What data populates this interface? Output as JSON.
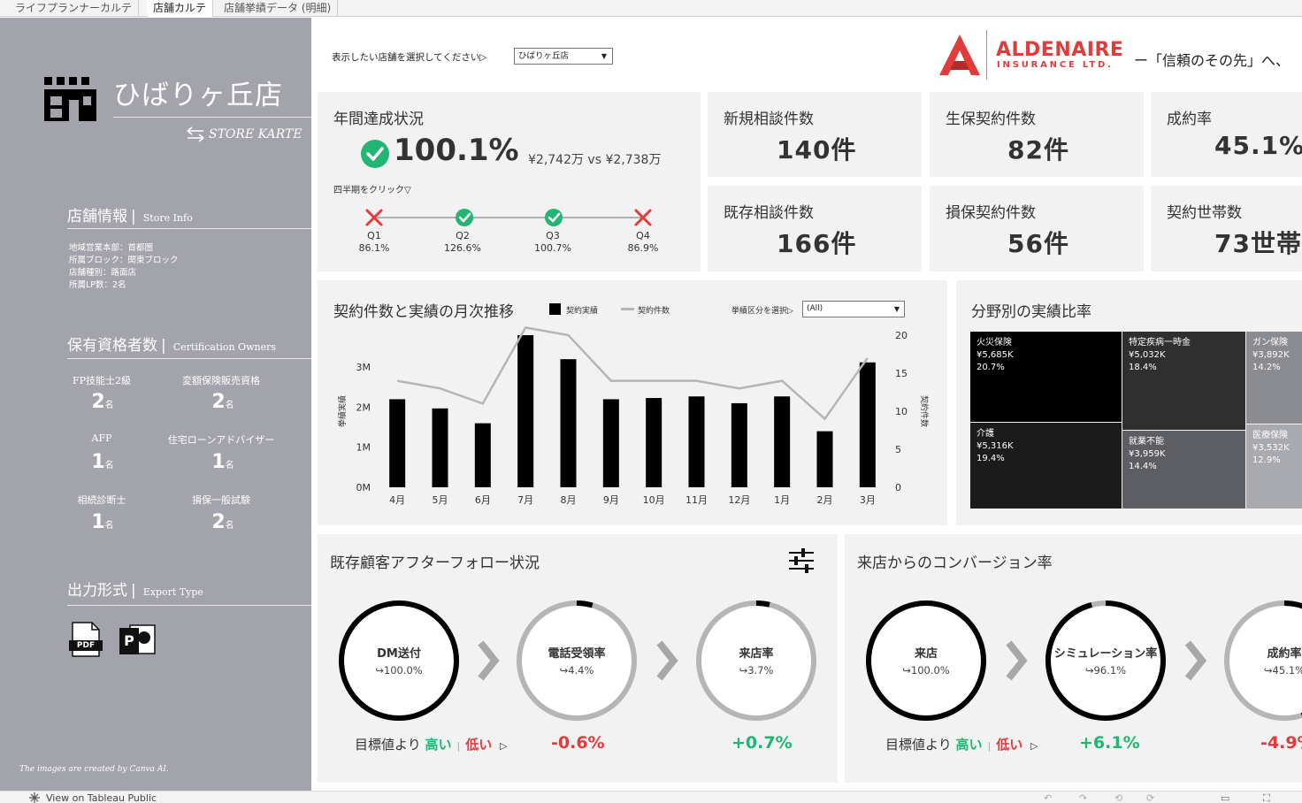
{
  "tabs": [
    {
      "label": "ライフプランナーカルテ"
    },
    {
      "label": "店舗カルテ"
    },
    {
      "label": "店舗挙績データ (明細)"
    }
  ],
  "sidebar": {
    "store_name": "ひばりヶ丘店",
    "store_karte": "STORE KARTE",
    "store_info": {
      "title": "店舗情報",
      "subtitle": "Store Info",
      "lines": [
        "地域営業本部：首都圏",
        "所属ブロック：関東ブロック",
        "店舗種別：路面店",
        "所属LP数：2名"
      ]
    },
    "certifications": {
      "title": "保有資格者数",
      "subtitle": "Certification Owners",
      "unit": "名",
      "items": [
        {
          "label": "FP技能士2級",
          "count": "2"
        },
        {
          "label": "変額保険販売資格",
          "count": "2"
        },
        {
          "label": "AFP",
          "count": "1"
        },
        {
          "label": "住宅ローンアドバイザー",
          "count": "1"
        },
        {
          "label": "相続診断士",
          "count": "1"
        },
        {
          "label": "損保一般試験",
          "count": "2"
        }
      ]
    },
    "export": {
      "title": "出力形式",
      "subtitle": "Export Type",
      "pdf_label": "PDF",
      "ppt_label": "P"
    },
    "credit": "The images are created by Canva AI."
  },
  "header": {
    "select_label": "表示したい店舗を選択してください▷",
    "select_value": "ひばりヶ丘店",
    "brand_name": "ALDENAIRE",
    "brand_sub": "INSURANCE LTD.",
    "tagline": "ー「信頼のその先」へ、"
  },
  "annual": {
    "title": "年間達成状況",
    "rate": "100.1%",
    "amounts": "¥2,742万 vs ¥2,738万",
    "hint": "四半期をクリック▽",
    "quarters": [
      {
        "label": "Q1",
        "value": "86.1%",
        "achieved": false
      },
      {
        "label": "Q2",
        "value": "126.6%",
        "achieved": true
      },
      {
        "label": "Q3",
        "value": "100.7%",
        "achieved": true
      },
      {
        "label": "Q4",
        "value": "86.9%",
        "achieved": false
      }
    ]
  },
  "kpis": [
    {
      "title": "新規相談件数",
      "value": "140件"
    },
    {
      "title": "生保契約件数",
      "value": "82件"
    },
    {
      "title": "成約率",
      "value": "45.1%"
    },
    {
      "title": "既存相談件数",
      "value": "166件"
    },
    {
      "title": "損保契約件数",
      "value": "56件"
    },
    {
      "title": "契約世帯数",
      "value": "73世帯"
    }
  ],
  "monthly": {
    "title": "契約件数と実績の月次推移",
    "legend_bar": "契約実績",
    "legend_line": "契約件数",
    "filter_label": "挙績区分を選択▷",
    "filter_value": "(All)"
  },
  "treemap": {
    "title": "分野別の実績比率",
    "cells": [
      {
        "name": "火災保険",
        "amount": "¥5,685K",
        "pct": "20.7%"
      },
      {
        "name": "特定疾病一時金",
        "amount": "¥5,032K",
        "pct": "18.4%"
      },
      {
        "name": "ガン保険",
        "amount": "¥3,892K",
        "pct": "14.2%"
      },
      {
        "name": "介護",
        "amount": "¥5,316K",
        "pct": "19.4%"
      },
      {
        "name": "就業不能",
        "amount": "¥3,959K",
        "pct": "14.4%"
      },
      {
        "name": "医療保険",
        "amount": "¥3,532K",
        "pct": "12.9%"
      }
    ]
  },
  "followup": {
    "title": "既存顧客アフターフォロー状況",
    "rings": [
      {
        "title": "DM送付",
        "value": "↪100.0%",
        "fraction": 1.0
      },
      {
        "title": "電話受領率",
        "value": "↪4.4%",
        "fraction": 0.044
      },
      {
        "title": "来店率",
        "value": "↪3.7%",
        "fraction": 0.037
      }
    ],
    "compare_prefix": "目標値より",
    "compare_high": "高い",
    "compare_sep": "|",
    "compare_low": "低い",
    "compare_arrow": "▷",
    "deltas": [
      "-0.6%",
      "+0.7%"
    ]
  },
  "conversion": {
    "title": "来店からのコンバージョン率",
    "rings": [
      {
        "title": "来店",
        "value": "↪100.0%",
        "fraction": 1.0
      },
      {
        "title": "シミュレーション率",
        "value": "↪96.1%",
        "fraction": 0.961
      },
      {
        "title": "成約率",
        "value": "↪45.1%",
        "fraction": 0.451
      }
    ],
    "compare_prefix": "目標値より",
    "compare_high": "高い",
    "compare_sep": "|",
    "compare_low": "低い",
    "compare_arrow": "▷",
    "deltas": [
      "+6.1%",
      "-4.9%"
    ]
  },
  "footer": {
    "view_label": "View on Tableau Public"
  },
  "colors": {
    "sidebar": "#a3a4ab",
    "card": "#f2f2f2",
    "good": "#22b573",
    "bad": "#e23b3b",
    "dark": "#000000",
    "line": "#b5b5b5"
  },
  "chart_data": {
    "type": "bar",
    "title": "契約件数と実績の月次推移",
    "categories": [
      "4月",
      "5月",
      "6月",
      "7月",
      "8月",
      "9月",
      "10月",
      "11月",
      "12月",
      "1月",
      "2月",
      "3月"
    ],
    "series": [
      {
        "name": "契約実績",
        "type": "bar",
        "axis": "left",
        "values": [
          2.2,
          1.97,
          1.6,
          3.8,
          3.2,
          2.2,
          2.23,
          2.27,
          2.1,
          2.27,
          1.4,
          3.12
        ]
      },
      {
        "name": "契約件数",
        "type": "line",
        "axis": "right",
        "values": [
          14,
          13,
          11,
          21,
          20,
          14,
          14,
          14,
          13,
          14,
          9,
          17
        ]
      }
    ],
    "ylabel": "挙績実績",
    "ylabel_right": "契約件数",
    "y_left_ticks": [
      "0M",
      "1M",
      "2M",
      "3M"
    ],
    "y_right_ticks": [
      "0",
      "5",
      "10",
      "15",
      "20"
    ],
    "ylim_left": [
      0,
      3.8
    ],
    "ylim_right": [
      0,
      20
    ],
    "grid": false
  }
}
